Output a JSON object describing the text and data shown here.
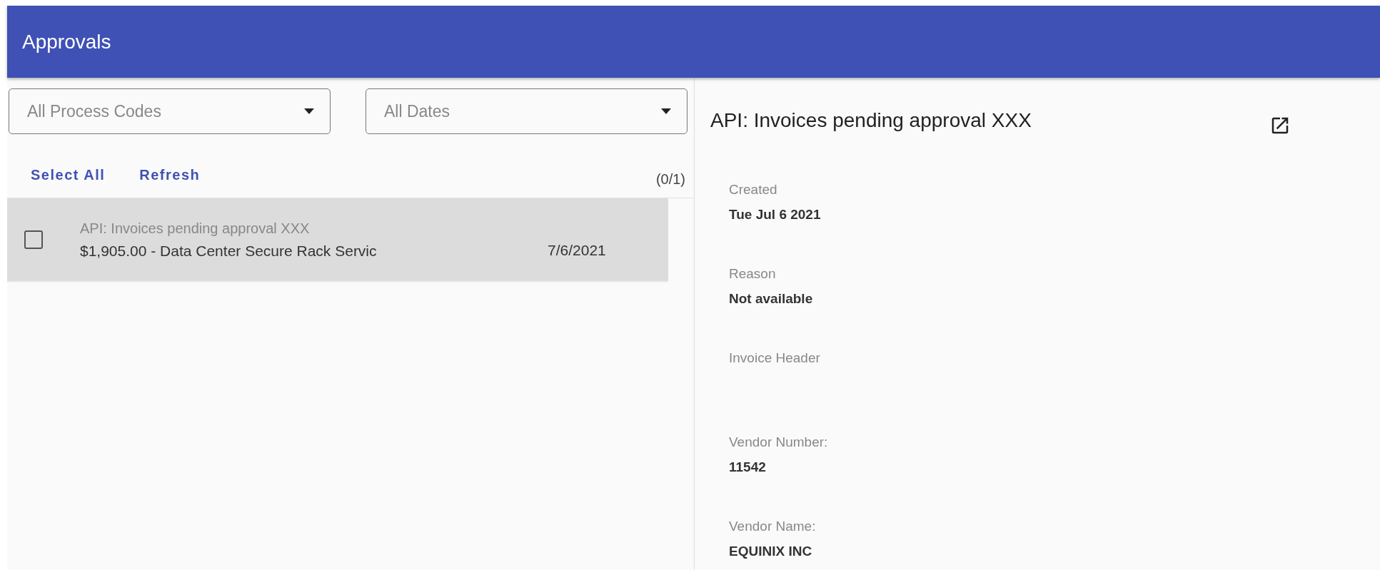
{
  "app_bar": {
    "title": "Approvals"
  },
  "filters": [
    {
      "placeholder": "All Process Codes"
    },
    {
      "placeholder": "All Dates"
    }
  ],
  "actions": [
    "Select All",
    "Refresh"
  ],
  "count": "(0/1)",
  "list": [
    {
      "title": "API: Invoices pending approval XXX",
      "summary": "$1,905.00 - Data Center Secure Rack Servic",
      "date": "7/6/2021",
      "checked": false,
      "selected": true
    }
  ],
  "detail": {
    "title": "API: Invoices pending approval XXX",
    "fields": [
      {
        "kind": "field",
        "label": "Created",
        "value": "Tue Jul 6 2021"
      },
      {
        "kind": "field",
        "label": "Reason",
        "value": "Not available"
      },
      {
        "kind": "section",
        "label": "Invoice Header"
      },
      {
        "kind": "field",
        "label": "Vendor Number:",
        "value": "11542"
      },
      {
        "kind": "field",
        "label": "Vendor Name:",
        "value": "EQUINIX INC"
      }
    ]
  }
}
